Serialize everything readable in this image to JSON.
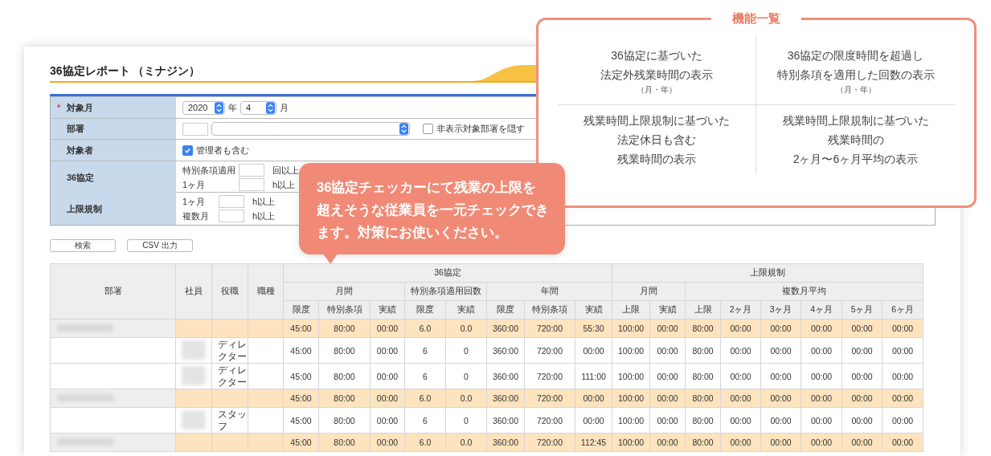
{
  "report": {
    "title": "36協定レポート （ミナジン）",
    "form": [
      {
        "kind": "month",
        "label": "対象月",
        "required_mark": "*",
        "year": "2020",
        "year_unit": "年",
        "month": "4",
        "month_unit": "月"
      },
      {
        "kind": "department",
        "label": "部署",
        "checkbox": {
          "label": "非表示対象部署を隠す",
          "checked": false
        }
      },
      {
        "kind": "checkbox",
        "label": "対象者",
        "checkbox": {
          "label": "管理者も含む",
          "checked": true
        }
      },
      {
        "kind": "thresholds",
        "label": "36協定",
        "lines": [
          {
            "label": "特別条項適用",
            "unit": "回以上"
          },
          {
            "label": "1ヶ月",
            "unit": "h以上"
          }
        ]
      },
      {
        "kind": "thresholds",
        "label": "上限規制",
        "lines": [
          {
            "label": "1ヶ月",
            "unit": "h以上"
          },
          {
            "label": "複数月",
            "unit": "h以上"
          }
        ]
      }
    ],
    "buttons": [
      "検索",
      "CSV 出力"
    ],
    "table": {
      "fixed_columns": [
        "部署",
        "社員",
        "役職",
        "職種"
      ],
      "groups": [
        {
          "label": "36協定",
          "subgroups": [
            {
              "label": "月間",
              "columns": [
                "限度",
                "特別条項",
                "実績"
              ]
            },
            {
              "label": "特別条項適用回数",
              "columns": [
                "限度",
                "実績"
              ]
            },
            {
              "label": "年間",
              "columns": [
                "限度",
                "特別条項",
                "実績"
              ]
            }
          ]
        },
        {
          "label": "上限規制",
          "subgroups": [
            {
              "label": "月間",
              "columns": [
                "上限",
                "実績"
              ]
            },
            {
              "label": "複数月平均",
              "columns": [
                "上限",
                "2ヶ月",
                "3ヶ月",
                "4ヶ月",
                "5ヶ月",
                "6ヶ月"
              ]
            }
          ]
        }
      ],
      "rows": [
        {
          "kind": "group",
          "values": [
            "45:00",
            "80:00",
            "00:00",
            "6.0",
            "0.0",
            "360:00",
            "720:00",
            "55:30",
            "100:00",
            "00:00",
            "80:00",
            "00:00",
            "00:00",
            "00:00",
            "00:00",
            "00:00"
          ]
        },
        {
          "kind": "employee",
          "role": "ディレクター",
          "values": [
            "45:00",
            "80:00",
            "00:00",
            "6",
            "0",
            "360:00",
            "720:00",
            "00:00",
            "100:00",
            "00:00",
            "80:00",
            "00:00",
            "00:00",
            "00:00",
            "00:00",
            "00:00"
          ]
        },
        {
          "kind": "employee",
          "role": "ディレクター",
          "values": [
            "45:00",
            "80:00",
            "00:00",
            "6",
            "0",
            "360:00",
            "720:00",
            "111:00",
            "100:00",
            "00:00",
            "80:00",
            "00:00",
            "00:00",
            "00:00",
            "00:00",
            "00:00"
          ]
        },
        {
          "kind": "group",
          "values": [
            "45:00",
            "80:00",
            "00:00",
            "6.0",
            "0.0",
            "360:00",
            "720:00",
            "00:00",
            "100:00",
            "00:00",
            "80:00",
            "00:00",
            "00:00",
            "00:00",
            "00:00",
            "00:00"
          ]
        },
        {
          "kind": "employee",
          "role": "スタッフ",
          "values": [
            "45:00",
            "80:00",
            "00:00",
            "6",
            "0",
            "360:00",
            "720:00",
            "00:00",
            "100:00",
            "00:00",
            "80:00",
            "00:00",
            "00:00",
            "00:00",
            "00:00",
            "00:00"
          ]
        },
        {
          "kind": "group",
          "values": [
            "45:00",
            "80:00",
            "00:00",
            "6.0",
            "0.0",
            "360:00",
            "720:00",
            "112:45",
            "100:00",
            "00:00",
            "80:00",
            "00:00",
            "00:00",
            "00:00",
            "00:00",
            "00:00"
          ]
        }
      ]
    }
  },
  "callout": {
    "lines": [
      "36協定チェッカーにて残業の上限を",
      "超えそうな従業員を一元チェックでき",
      "ます。対策にお使いください。"
    ]
  },
  "features": {
    "title": "機能一覧",
    "items": [
      {
        "lines": [
          "36協定に基づいた",
          "法定外残業時間の表示"
        ],
        "note": "（月・年）"
      },
      {
        "lines": [
          "36協定の限度時間を超過し",
          "特別条項を適用した回数の表示"
        ],
        "note": "（月・年）"
      },
      {
        "lines": [
          "残業時間上限規制に基づいた",
          "法定休日も含む",
          "残業時間の表示"
        ]
      },
      {
        "lines": [
          "残業時間上限規制に基づいた",
          "残業時間の",
          "2ヶ月〜6ヶ月平均の表示"
        ]
      }
    ]
  }
}
